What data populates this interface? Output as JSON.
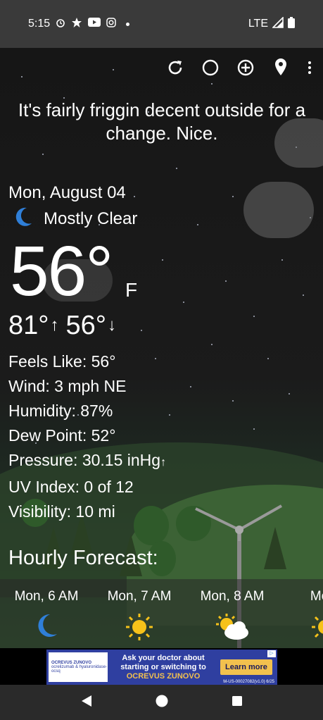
{
  "status_bar": {
    "time": "5:15",
    "network": "LTE"
  },
  "toolbar": {
    "icons": [
      "refresh-icon",
      "theme-icon",
      "add-location-icon",
      "location-icon",
      "more-icon"
    ]
  },
  "headline": "It's fairly friggin decent outside for a change. Nice.",
  "current": {
    "date": "Mon, August 04",
    "condition": "Mostly Clear",
    "temperature": "56°",
    "unit": "F",
    "high": "81°",
    "low": "56°"
  },
  "details": {
    "feels_like": "Feels Like:  56°",
    "wind": "Wind:  3 mph NE",
    "humidity": "Humidity:  87%",
    "dew_point": "Dew Point:  52°",
    "pressure": "Pressure:  30.15 inHg",
    "uv_index": "UV Index:  0 of 12",
    "visibility": "Visibility:  10 mi"
  },
  "hourly": {
    "title": "Hourly Forecast:",
    "items": [
      {
        "time": "Mon, 6 AM",
        "icon": "moon-icon"
      },
      {
        "time": "Mon, 7 AM",
        "icon": "sun-icon"
      },
      {
        "time": "Mon, 8 AM",
        "icon": "partly-cloudy-icon"
      },
      {
        "time": "Mon,",
        "icon": "sun-icon"
      }
    ]
  },
  "ad": {
    "logo_line1": "OCREVUS ZUNOVO",
    "logo_line2": "ocrelizumab & hyaluronidase-ocsq",
    "line1": "Ask your doctor about",
    "line2": "starting or switching to",
    "brand": "OCREVUS ZUNOVO",
    "button": "Learn more",
    "code": "M-US-00027082(v1.0) 6/25"
  },
  "colors": {
    "sun": "#f6c21a",
    "moon": "#2f7fd8",
    "ad_bg": "#2f3fa0",
    "ad_button": "#f2c14e"
  }
}
